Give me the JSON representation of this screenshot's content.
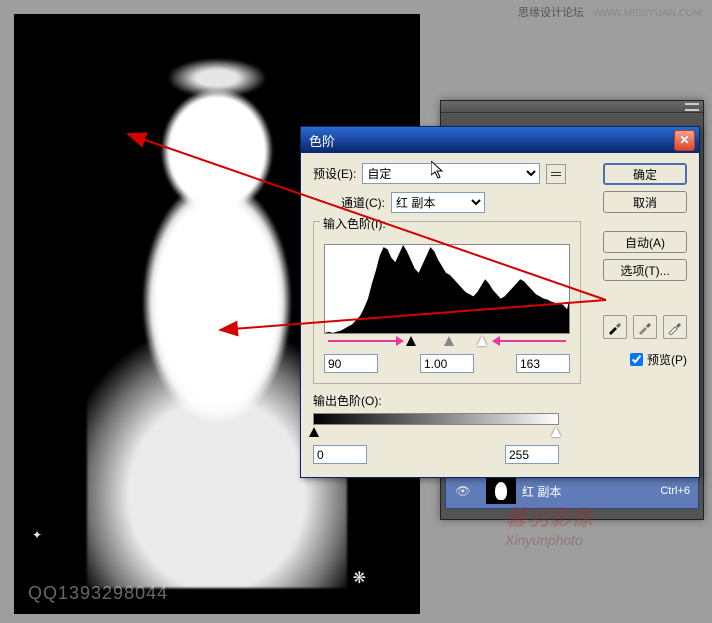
{
  "watermark": {
    "site": "思缘设计论坛",
    "url": "WWW.MISSYUAN.COM"
  },
  "canvas": {
    "corner_text": "QQ1393298044"
  },
  "channels_panel": {
    "row": {
      "name": "红 副本",
      "shortcut": "Ctrl+6"
    }
  },
  "center_watermark": {
    "line1": "馨羽影像",
    "line2": "Xinyunphoto"
  },
  "dialog": {
    "title": "色阶",
    "preset_label": "预设(E):",
    "preset_value": "自定",
    "channel_label": "通道(C):",
    "channel_value": "红 副本",
    "input_levels_label": "输入色阶(I):",
    "input_values": {
      "shadow": "90",
      "mid": "1.00",
      "highlight": "163"
    },
    "output_levels_label": "输出色阶(O):",
    "output_values": {
      "low": "0",
      "high": "255"
    },
    "buttons": {
      "ok": "确定",
      "cancel": "取消",
      "auto": "自动(A)",
      "options": "选项(T)..."
    },
    "preview_label": "预览(P)"
  },
  "chart_data": {
    "type": "area",
    "title": "",
    "xlabel": "",
    "ylabel": "",
    "x_range": [
      0,
      255
    ],
    "values": [
      2,
      3,
      2,
      3,
      4,
      6,
      8,
      10,
      14,
      18,
      25,
      34,
      48,
      60,
      74,
      82,
      80,
      72,
      68,
      76,
      84,
      78,
      70,
      62,
      58,
      66,
      74,
      82,
      78,
      70,
      64,
      58,
      56,
      52,
      48,
      44,
      40,
      38,
      36,
      40,
      46,
      52,
      48,
      42,
      38,
      34,
      36,
      40,
      44,
      48,
      52,
      50,
      46,
      42,
      38,
      36,
      34,
      33,
      31,
      30,
      29,
      28,
      24,
      40
    ]
  }
}
